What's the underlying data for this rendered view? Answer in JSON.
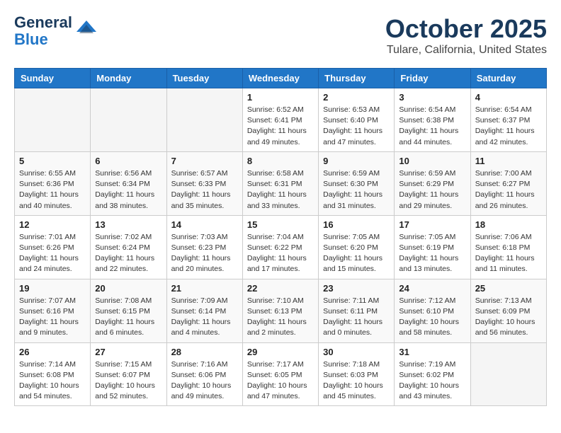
{
  "header": {
    "logo_line1": "General",
    "logo_line2": "Blue",
    "month_title": "October 2025",
    "location": "Tulare, California, United States"
  },
  "days_of_week": [
    "Sunday",
    "Monday",
    "Tuesday",
    "Wednesday",
    "Thursday",
    "Friday",
    "Saturday"
  ],
  "weeks": [
    [
      {
        "day": "",
        "info": ""
      },
      {
        "day": "",
        "info": ""
      },
      {
        "day": "",
        "info": ""
      },
      {
        "day": "1",
        "info": "Sunrise: 6:52 AM\nSunset: 6:41 PM\nDaylight: 11 hours and 49 minutes."
      },
      {
        "day": "2",
        "info": "Sunrise: 6:53 AM\nSunset: 6:40 PM\nDaylight: 11 hours and 47 minutes."
      },
      {
        "day": "3",
        "info": "Sunrise: 6:54 AM\nSunset: 6:38 PM\nDaylight: 11 hours and 44 minutes."
      },
      {
        "day": "4",
        "info": "Sunrise: 6:54 AM\nSunset: 6:37 PM\nDaylight: 11 hours and 42 minutes."
      }
    ],
    [
      {
        "day": "5",
        "info": "Sunrise: 6:55 AM\nSunset: 6:36 PM\nDaylight: 11 hours and 40 minutes."
      },
      {
        "day": "6",
        "info": "Sunrise: 6:56 AM\nSunset: 6:34 PM\nDaylight: 11 hours and 38 minutes."
      },
      {
        "day": "7",
        "info": "Sunrise: 6:57 AM\nSunset: 6:33 PM\nDaylight: 11 hours and 35 minutes."
      },
      {
        "day": "8",
        "info": "Sunrise: 6:58 AM\nSunset: 6:31 PM\nDaylight: 11 hours and 33 minutes."
      },
      {
        "day": "9",
        "info": "Sunrise: 6:59 AM\nSunset: 6:30 PM\nDaylight: 11 hours and 31 minutes."
      },
      {
        "day": "10",
        "info": "Sunrise: 6:59 AM\nSunset: 6:29 PM\nDaylight: 11 hours and 29 minutes."
      },
      {
        "day": "11",
        "info": "Sunrise: 7:00 AM\nSunset: 6:27 PM\nDaylight: 11 hours and 26 minutes."
      }
    ],
    [
      {
        "day": "12",
        "info": "Sunrise: 7:01 AM\nSunset: 6:26 PM\nDaylight: 11 hours and 24 minutes."
      },
      {
        "day": "13",
        "info": "Sunrise: 7:02 AM\nSunset: 6:24 PM\nDaylight: 11 hours and 22 minutes."
      },
      {
        "day": "14",
        "info": "Sunrise: 7:03 AM\nSunset: 6:23 PM\nDaylight: 11 hours and 20 minutes."
      },
      {
        "day": "15",
        "info": "Sunrise: 7:04 AM\nSunset: 6:22 PM\nDaylight: 11 hours and 17 minutes."
      },
      {
        "day": "16",
        "info": "Sunrise: 7:05 AM\nSunset: 6:20 PM\nDaylight: 11 hours and 15 minutes."
      },
      {
        "day": "17",
        "info": "Sunrise: 7:05 AM\nSunset: 6:19 PM\nDaylight: 11 hours and 13 minutes."
      },
      {
        "day": "18",
        "info": "Sunrise: 7:06 AM\nSunset: 6:18 PM\nDaylight: 11 hours and 11 minutes."
      }
    ],
    [
      {
        "day": "19",
        "info": "Sunrise: 7:07 AM\nSunset: 6:16 PM\nDaylight: 11 hours and 9 minutes."
      },
      {
        "day": "20",
        "info": "Sunrise: 7:08 AM\nSunset: 6:15 PM\nDaylight: 11 hours and 6 minutes."
      },
      {
        "day": "21",
        "info": "Sunrise: 7:09 AM\nSunset: 6:14 PM\nDaylight: 11 hours and 4 minutes."
      },
      {
        "day": "22",
        "info": "Sunrise: 7:10 AM\nSunset: 6:13 PM\nDaylight: 11 hours and 2 minutes."
      },
      {
        "day": "23",
        "info": "Sunrise: 7:11 AM\nSunset: 6:11 PM\nDaylight: 11 hours and 0 minutes."
      },
      {
        "day": "24",
        "info": "Sunrise: 7:12 AM\nSunset: 6:10 PM\nDaylight: 10 hours and 58 minutes."
      },
      {
        "day": "25",
        "info": "Sunrise: 7:13 AM\nSunset: 6:09 PM\nDaylight: 10 hours and 56 minutes."
      }
    ],
    [
      {
        "day": "26",
        "info": "Sunrise: 7:14 AM\nSunset: 6:08 PM\nDaylight: 10 hours and 54 minutes."
      },
      {
        "day": "27",
        "info": "Sunrise: 7:15 AM\nSunset: 6:07 PM\nDaylight: 10 hours and 52 minutes."
      },
      {
        "day": "28",
        "info": "Sunrise: 7:16 AM\nSunset: 6:06 PM\nDaylight: 10 hours and 49 minutes."
      },
      {
        "day": "29",
        "info": "Sunrise: 7:17 AM\nSunset: 6:05 PM\nDaylight: 10 hours and 47 minutes."
      },
      {
        "day": "30",
        "info": "Sunrise: 7:18 AM\nSunset: 6:03 PM\nDaylight: 10 hours and 45 minutes."
      },
      {
        "day": "31",
        "info": "Sunrise: 7:19 AM\nSunset: 6:02 PM\nDaylight: 10 hours and 43 minutes."
      },
      {
        "day": "",
        "info": ""
      }
    ]
  ]
}
